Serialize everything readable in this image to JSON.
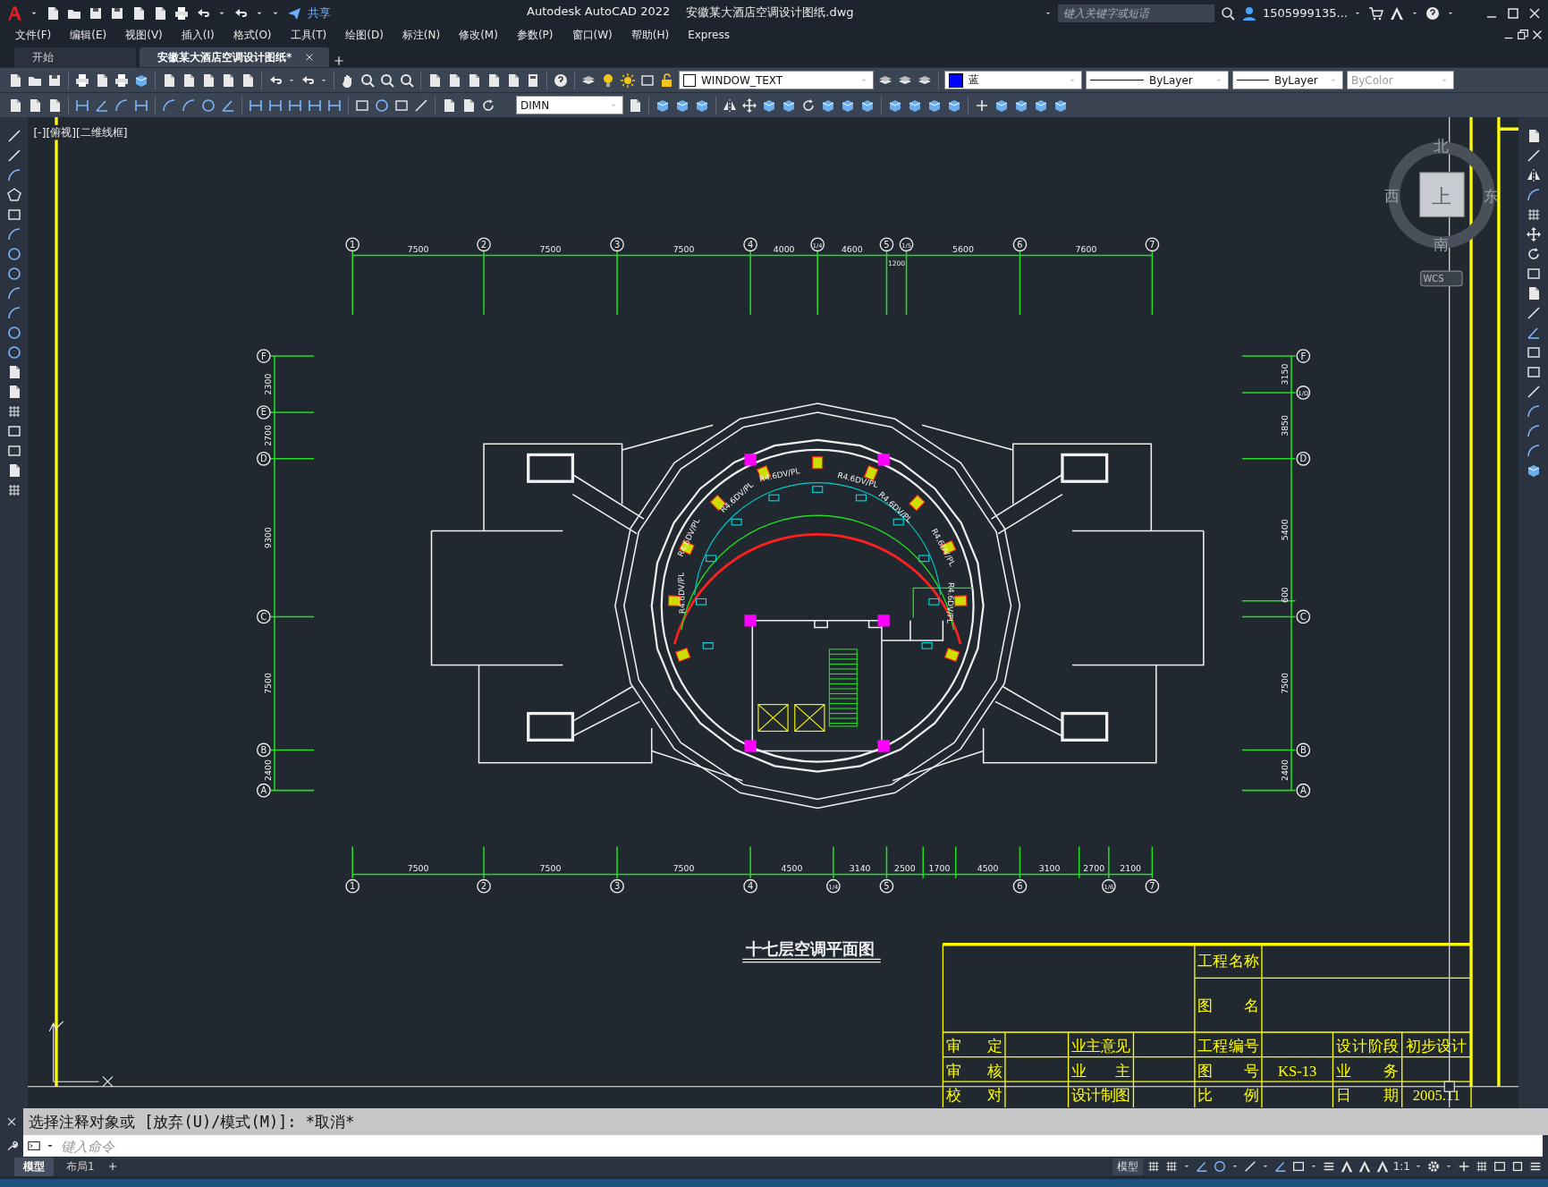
{
  "window": {
    "app_title": "Autodesk AutoCAD 2022",
    "file_title": "安徽某大酒店空调设计图纸.dwg"
  },
  "quick_access": {
    "share": "共享"
  },
  "search": {
    "placeholder": "键入关键字或短语"
  },
  "user": {
    "name": "1505999135..."
  },
  "menu": [
    "文件(F)",
    "编辑(E)",
    "视图(V)",
    "插入(I)",
    "格式(O)",
    "工具(T)",
    "绘图(D)",
    "标注(N)",
    "修改(M)",
    "参数(P)",
    "窗口(W)",
    "帮助(H)",
    "Express"
  ],
  "tabs": [
    {
      "label": "开始",
      "selected": false
    },
    {
      "label": "安徽某大酒店空调设计图纸*",
      "selected": true
    }
  ],
  "toolbar": {
    "layer": "WINDOW_TEXT",
    "color_label": "蓝",
    "linetype": "ByLayer",
    "lineweight": "ByLayer",
    "plot_style": "ByColor",
    "dim_style": "DIMN"
  },
  "viewport": {
    "label": "[-][俯视][二维线框]"
  },
  "viewcube": {
    "north": "北",
    "south": "南",
    "east": "东",
    "west": "西",
    "face": "上",
    "ucs": "WCS"
  },
  "drawing": {
    "top_axes": [
      "1",
      "2",
      "3",
      "4",
      "1/4",
      "5",
      "1/5",
      "6",
      "7"
    ],
    "top_dims": [
      "7500",
      "7500",
      "7500",
      "4000",
      "4600",
      "1200",
      "5600",
      "7600"
    ],
    "bottom_axes": [
      "1",
      "2",
      "3",
      "4",
      "1/4",
      "5",
      "6",
      "1/6",
      "7"
    ],
    "bottom_dims": [
      "7500",
      "7500",
      "7500",
      "4500",
      "3140",
      "2500",
      "1700",
      "4500",
      "3100",
      "2700",
      "2100"
    ],
    "left_axes": [
      "F",
      "E",
      "D",
      "C",
      "B",
      "A"
    ],
    "left_dims": [
      "2300",
      "2700",
      "9300",
      "7500",
      "2400"
    ],
    "right_axes": [
      "F",
      "1/D",
      "D",
      "C",
      "B",
      "A"
    ],
    "right_dims": [
      "3150",
      "3850",
      "5400",
      "600",
      "7500",
      "2400"
    ],
    "duct_labels": [
      "R4.6DV/PL",
      "R4.6DV/PL",
      "R4.6DV/PL",
      "R4.6DV/PL",
      "R4.6DV/PL",
      "R4.6DV/PL",
      "R4.6DV/PL",
      "R4.6DV/PL"
    ],
    "title": "十七层空调平面图"
  },
  "title_block": {
    "project_name_label": "工程名称",
    "drawing_name_label": "图名",
    "rows": [
      {
        "label_1": "审定",
        "label_2": "业主意见",
        "label_3": "工程编号",
        "label_4": "设计阶段",
        "value_4": "初步设计"
      },
      {
        "label_1": "审核",
        "label_2": "业主",
        "label_3": "图号",
        "value_3": "KS-13",
        "label_4": "业务"
      },
      {
        "label_1": "校对",
        "label_2": "设计制图",
        "label_3": "比例",
        "label_4": "日期",
        "value_4": "2005.11"
      }
    ]
  },
  "command": {
    "history": "选择注释对象或 [放弃(U)/模式(M)]: *取消*",
    "placeholder": "键入命令"
  },
  "layout_tabs": [
    {
      "label": "模型",
      "selected": true
    },
    {
      "label": "布局1",
      "selected": false
    }
  ],
  "status": {
    "mode": "模型",
    "scale": "1:1"
  }
}
